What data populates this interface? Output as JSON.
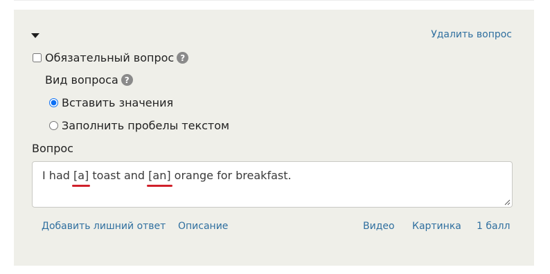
{
  "question": {
    "delete_label": "Удалить вопрос",
    "required_label": "Обязательный вопрос",
    "required_checked": false,
    "kind_label": "Вид вопроса",
    "kind_options": [
      {
        "label": "Вставить значения",
        "selected": true
      },
      {
        "label": "Заполнить пробелы текстом",
        "selected": false
      }
    ],
    "question_label": "Вопрос",
    "text_parts": [
      "I had ",
      "[a]",
      " toast and ",
      "[an]",
      " orange for breakfast."
    ],
    "footer": {
      "extra_answer": "Добавить лишний ответ",
      "description": "Описание",
      "video": "Видео",
      "picture": "Картинка",
      "score": "1 балл"
    }
  },
  "icons": {
    "collapse": "caret-down-icon",
    "help": "question-circle-icon",
    "resize": "resize-grip-icon"
  },
  "colors": {
    "panel_bg": "#efefe9",
    "link": "#2f6f9f",
    "gap_underline": "#d0202a",
    "radio_accent": "#0b6ff4"
  }
}
